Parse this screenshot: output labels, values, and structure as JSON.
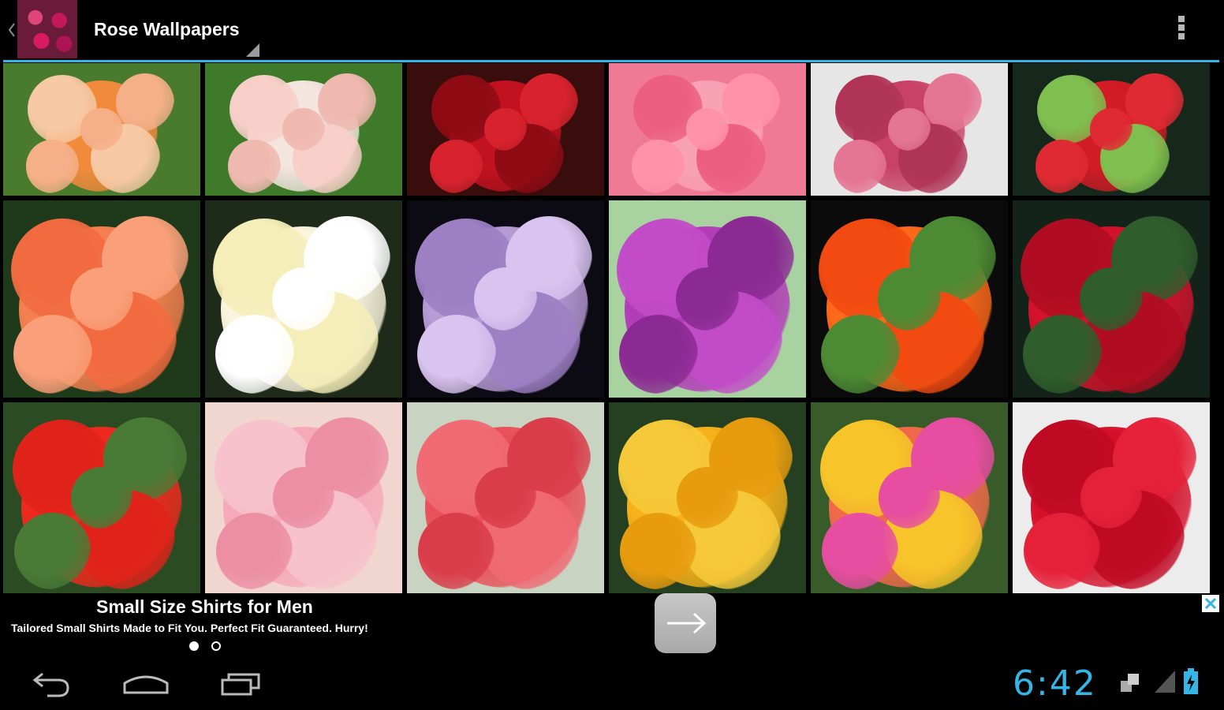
{
  "action_bar": {
    "title": "Rose Wallpapers",
    "overflow_icon": "overflow-menu-icon"
  },
  "grid": {
    "tiles": [
      {
        "description_icon": "rose-thumbnail",
        "colors": [
          "#4a7a2e",
          "#f28a3c",
          "#f7c9a5",
          "#f5b08a"
        ]
      },
      {
        "description_icon": "rose-thumbnail",
        "colors": [
          "#3f7a2a",
          "#f4e5df",
          "#f7cfc8",
          "#efb9b0"
        ]
      },
      {
        "description_icon": "rose-thumbnail",
        "colors": [
          "#3a0d0d",
          "#c2121f",
          "#8e0b14",
          "#d8232e"
        ]
      },
      {
        "description_icon": "rose-thumbnail",
        "colors": [
          "#f07a95",
          "#f9a2b5",
          "#ec5f80",
          "#ff92a8"
        ]
      },
      {
        "description_icon": "rose-thumbnail",
        "colors": [
          "#e6e6e6",
          "#c74266",
          "#b03458",
          "#e57594"
        ]
      },
      {
        "description_icon": "rose-thumbnail",
        "colors": [
          "#16281c",
          "#d11b25",
          "#7fbf4f",
          "#e02a33"
        ]
      },
      {
        "description_icon": "rose-thumbnail",
        "colors": [
          "#1f3a1a",
          "#f5804f",
          "#f26b40",
          "#f9a07a"
        ]
      },
      {
        "description_icon": "rose-thumbnail",
        "colors": [
          "#1e2b1a",
          "#fbf5df",
          "#f6eeb9",
          "#ffffff"
        ]
      },
      {
        "description_icon": "rose-thumbnail",
        "colors": [
          "#0c0a12",
          "#b79ad6",
          "#9d7fc4",
          "#d9c3ef"
        ]
      },
      {
        "description_icon": "rose-thumbnail",
        "colors": [
          "#a8d3a0",
          "#b23bb8",
          "#c24bc8",
          "#8a2a92"
        ]
      },
      {
        "description_icon": "rose-thumbnail",
        "colors": [
          "#0b0b0b",
          "#ff6a1a",
          "#f24a10",
          "#4c8a34"
        ]
      },
      {
        "description_icon": "rose-thumbnail",
        "colors": [
          "#13231a",
          "#d3122c",
          "#b10d22",
          "#2f5d2c"
        ]
      },
      {
        "description_icon": "rose-thumbnail",
        "colors": [
          "#2b4b22",
          "#ee2a1f",
          "#e0231a",
          "#4a7b36"
        ]
      },
      {
        "description_icon": "rose-thumbnail",
        "colors": [
          "#f1d6cf",
          "#f5a9b9",
          "#f7c2cc",
          "#ec8ea4"
        ]
      },
      {
        "description_icon": "rose-thumbnail",
        "colors": [
          "#c9d3c2",
          "#e9505b",
          "#f06a73",
          "#d93d4a"
        ]
      },
      {
        "description_icon": "rose-thumbnail",
        "colors": [
          "#244020",
          "#f7b21a",
          "#f6c93a",
          "#e79c0e"
        ]
      },
      {
        "description_icon": "rose-thumbnail",
        "colors": [
          "#385b2a",
          "#f06a4a",
          "#f7c429",
          "#e74da0"
        ]
      },
      {
        "description_icon": "rose-thumbnail",
        "colors": [
          "#ececec",
          "#d50f2a",
          "#c00a24",
          "#e5213a"
        ]
      }
    ]
  },
  "ad": {
    "title": "Small Size Shirts for Men",
    "description": "Tailored Small Shirts Made to Fit You. Perfect Fit Guaranteed. Hurry!",
    "arrow_icon": "arrow-right-icon",
    "close_icon": "ad-choices-icon"
  },
  "navbar": {
    "back_icon": "back-icon",
    "home_icon": "home-icon",
    "recents_icon": "recent-apps-icon"
  },
  "status": {
    "time": "6:42",
    "sync_icon": "sync-icon",
    "signal_icon": "signal-icon",
    "battery_icon": "battery-charging-icon",
    "accent": "#33b5e5"
  }
}
